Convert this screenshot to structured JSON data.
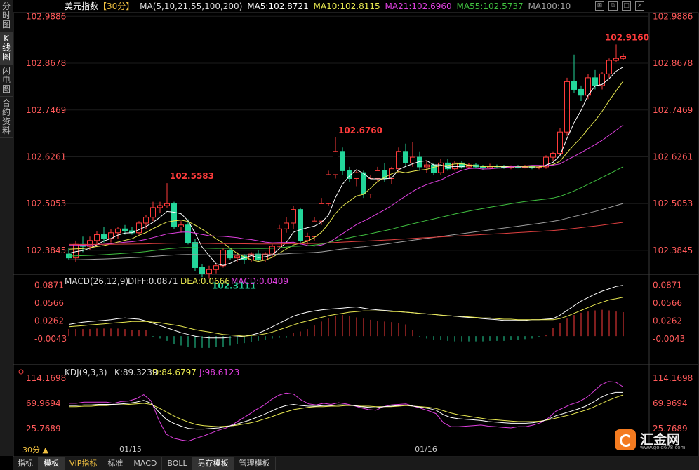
{
  "sidebar": {
    "tabs": [
      {
        "label": "分时图",
        "active": false
      },
      {
        "label": "K线图",
        "active": true
      },
      {
        "label": "闪电图",
        "active": false
      },
      {
        "label": "合约资料",
        "active": false
      }
    ]
  },
  "header": {
    "symbol": "美元指数",
    "period": "【30分】",
    "ma_legend": "MA(5,10,21,55,100,200)",
    "ma5": "MA5:102.8721",
    "ma10": "MA10:102.8115",
    "ma21": "MA21:102.6960",
    "ma55": "MA55:102.5737",
    "ma100": "MA100:10"
  },
  "colors": {
    "up": "#ff3b3b",
    "down": "#23d69a",
    "ma5": "#ffffff",
    "ma10": "#e8e850",
    "ma21": "#e040e0",
    "ma55": "#40c040",
    "ma100": "#a0a0a0",
    "ma200": "#e04040",
    "price_axis": "#ff5a5a",
    "indicator_axis": "#ff5a5a"
  },
  "price_axis": [
    "102.9886",
    "102.8678",
    "102.7469",
    "102.6261",
    "102.5053",
    "102.3845"
  ],
  "annotations": {
    "h1": "102.5583",
    "low": "102.3111",
    "h2": "102.6760",
    "h3": "102.9160"
  },
  "date_labels": [
    "01/15",
    "01/16"
  ],
  "macd": {
    "title": "MACD(26,12,9)",
    "diff": "DIFF:0.0871",
    "dea": "DEA:0.0666",
    "macd": "MACD:0.0409",
    "axis": [
      "0.0871",
      "0.0566",
      "0.0262",
      "-0.0043"
    ]
  },
  "kdj": {
    "title": "KDJ(9,3,3)",
    "k": "K:89.3239",
    "d": "D:84.6797",
    "j": "J:98.6123",
    "axis": [
      "114.1698",
      "69.9694",
      "25.7689"
    ]
  },
  "bottom_bar": {
    "period_label": "30分 ▲",
    "tabs": [
      {
        "label": "指标",
        "active": false
      },
      {
        "label": "模板",
        "active": true
      },
      {
        "label": "VIP指标",
        "active": false
      },
      {
        "label": "标准",
        "active": false
      },
      {
        "label": "MACD",
        "active": false
      },
      {
        "label": "BOLL",
        "active": false
      },
      {
        "label": "另存模板",
        "active": true
      },
      {
        "label": "管理模板",
        "active": false
      }
    ]
  },
  "logo": {
    "text": "汇金网",
    "url": "www.gold678.com"
  },
  "chart_data": [
    {
      "type": "candlestick",
      "title": "美元指数 30分",
      "ylim": [
        102.33,
        103.0
      ],
      "candles": [
        [
          102.375,
          102.39,
          102.36,
          102.365
        ],
        [
          102.365,
          102.41,
          102.355,
          102.4
        ],
        [
          102.4,
          102.42,
          102.38,
          102.395
        ],
        [
          102.395,
          102.42,
          102.385,
          102.41
        ],
        [
          102.41,
          102.435,
          102.4,
          102.425
        ],
        [
          102.425,
          102.445,
          102.405,
          102.415
        ],
        [
          102.415,
          102.44,
          102.405,
          102.43
        ],
        [
          102.43,
          102.445,
          102.415,
          102.44
        ],
        [
          102.44,
          102.45,
          102.425,
          102.435
        ],
        [
          102.435,
          102.445,
          102.425,
          102.43
        ],
        [
          102.43,
          102.46,
          102.425,
          102.455
        ],
        [
          102.455,
          102.475,
          102.44,
          102.47
        ],
        [
          102.47,
          102.51,
          102.46,
          102.495
        ],
        [
          102.495,
          102.51,
          102.48,
          102.5
        ],
        [
          102.5,
          102.558,
          102.495,
          102.505
        ],
        [
          102.505,
          102.51,
          102.44,
          102.445
        ],
        [
          102.445,
          102.46,
          102.43,
          102.45
        ],
        [
          102.45,
          102.465,
          102.4,
          102.405
        ],
        [
          102.405,
          102.415,
          102.33,
          102.34
        ],
        [
          102.34,
          102.35,
          102.315,
          102.325
        ],
        [
          102.325,
          102.345,
          102.311,
          102.335
        ],
        [
          102.335,
          102.35,
          102.325,
          102.345
        ],
        [
          102.345,
          102.39,
          102.34,
          102.385
        ],
        [
          102.385,
          102.39,
          102.36,
          102.365
        ],
        [
          102.365,
          102.38,
          102.355,
          102.37
        ],
        [
          102.37,
          102.375,
          102.35,
          102.36
        ],
        [
          102.36,
          102.38,
          102.355,
          102.375
        ],
        [
          102.375,
          102.385,
          102.355,
          102.36
        ],
        [
          102.36,
          102.38,
          102.355,
          102.375
        ],
        [
          102.375,
          102.4,
          102.365,
          102.395
        ],
        [
          102.395,
          102.45,
          102.39,
          102.44
        ],
        [
          102.44,
          102.47,
          102.43,
          102.455
        ],
        [
          102.455,
          102.5,
          102.44,
          102.49
        ],
        [
          102.49,
          102.495,
          102.4,
          102.41
        ],
        [
          102.41,
          102.43,
          102.4,
          102.42
        ],
        [
          102.42,
          102.47,
          102.41,
          102.46
        ],
        [
          102.46,
          102.52,
          102.45,
          102.505
        ],
        [
          102.505,
          102.59,
          102.5,
          102.58
        ],
        [
          102.58,
          102.676,
          102.57,
          102.64
        ],
        [
          102.64,
          102.65,
          102.58,
          102.59
        ],
        [
          102.59,
          102.6,
          102.56,
          102.57
        ],
        [
          102.57,
          102.59,
          102.55,
          102.585
        ],
        [
          102.585,
          102.59,
          102.52,
          102.53
        ],
        [
          102.53,
          102.58,
          102.52,
          102.57
        ],
        [
          102.57,
          102.6,
          102.56,
          102.59
        ],
        [
          102.59,
          102.61,
          102.56,
          102.57
        ],
        [
          102.57,
          102.6,
          102.555,
          102.595
        ],
        [
          102.595,
          102.65,
          102.585,
          102.64
        ],
        [
          102.64,
          102.66,
          102.6,
          102.61
        ],
        [
          102.61,
          102.665,
          102.6,
          102.625
        ],
        [
          102.625,
          102.64,
          102.59,
          102.6
        ],
        [
          102.6,
          102.615,
          102.585,
          102.605
        ],
        [
          102.605,
          102.61,
          102.58,
          102.585
        ],
        [
          102.585,
          102.62,
          102.58,
          102.61
        ],
        [
          102.61,
          102.62,
          102.59,
          102.595
        ],
        [
          102.595,
          102.615,
          102.59,
          102.61
        ],
        [
          102.61,
          102.615,
          102.595,
          102.6
        ],
        [
          102.6,
          102.61,
          102.595,
          102.605
        ],
        [
          102.605,
          102.61,
          102.595,
          102.6
        ],
        [
          102.6,
          102.605,
          102.592,
          102.598
        ],
        [
          102.598,
          102.608,
          102.595,
          102.602
        ],
        [
          102.602,
          102.606,
          102.596,
          102.6
        ],
        [
          102.6,
          102.605,
          102.595,
          102.598
        ],
        [
          102.598,
          102.604,
          102.594,
          102.602
        ],
        [
          102.602,
          102.605,
          102.596,
          102.599
        ],
        [
          102.599,
          102.605,
          102.596,
          102.601
        ],
        [
          102.601,
          102.603,
          102.594,
          102.598
        ],
        [
          102.598,
          102.603,
          102.594,
          102.6
        ],
        [
          102.6,
          102.63,
          102.595,
          102.625
        ],
        [
          102.625,
          102.64,
          102.615,
          102.635
        ],
        [
          102.635,
          102.7,
          102.63,
          102.69
        ],
        [
          102.69,
          102.83,
          102.68,
          102.82
        ],
        [
          102.82,
          102.89,
          102.79,
          102.8
        ],
        [
          102.8,
          102.81,
          102.77,
          102.785
        ],
        [
          102.785,
          102.84,
          102.775,
          102.83
        ],
        [
          102.83,
          102.85,
          102.8,
          102.81
        ],
        [
          102.81,
          102.845,
          102.8,
          102.84
        ],
        [
          102.84,
          102.88,
          102.83,
          102.875
        ],
        [
          102.875,
          102.916,
          102.87,
          102.88
        ],
        [
          102.88,
          102.892,
          102.876,
          102.885
        ]
      ]
    },
    {
      "type": "bar",
      "title": "MACD(26,12,9)",
      "ylim": [
        -0.025,
        0.095
      ],
      "values": [
        0.012,
        0.012,
        0.012,
        0.012,
        0.013,
        0.013,
        0.013,
        0.013,
        0.012,
        0.011,
        0.01,
        0.01,
        -0.001,
        -0.004,
        -0.008,
        -0.014,
        -0.016,
        -0.018,
        -0.02,
        -0.02,
        -0.02,
        -0.019,
        -0.018,
        -0.016,
        -0.014,
        -0.012,
        -0.01,
        -0.008,
        -0.006,
        -0.004,
        -0.003,
        -0.003,
        0.005,
        0.008,
        0.012,
        0.018,
        0.025,
        0.03,
        0.034,
        0.036,
        0.035,
        0.032,
        0.03,
        0.028,
        0.026,
        0.025,
        0.024,
        0.022,
        0.02,
        0.01,
        -0.002,
        -0.004,
        -0.006,
        -0.007,
        -0.008,
        -0.009,
        -0.009,
        -0.009,
        -0.009,
        -0.009,
        -0.008,
        -0.008,
        -0.008,
        -0.007,
        -0.006,
        -0.005,
        -0.004,
        -0.002,
        0.002,
        0.014,
        0.022,
        0.03,
        0.036,
        0.04,
        0.042,
        0.044,
        0.045,
        0.044,
        0.042,
        0.041
      ],
      "diff": [
        0.02,
        0.022,
        0.024,
        0.025,
        0.026,
        0.027,
        0.028,
        0.03,
        0.031,
        0.03,
        0.029,
        0.026,
        0.022,
        0.018,
        0.014,
        0.01,
        0.006,
        0.003,
        0.0,
        -0.002,
        -0.003,
        -0.003,
        -0.003,
        -0.002,
        -0.001,
        0.0,
        0.002,
        0.005,
        0.01,
        0.016,
        0.022,
        0.028,
        0.034,
        0.038,
        0.041,
        0.043,
        0.045,
        0.046,
        0.047,
        0.048,
        0.049,
        0.05,
        0.048,
        0.046,
        0.045,
        0.044,
        0.043,
        0.042,
        0.041,
        0.04,
        0.039,
        0.038,
        0.037,
        0.036,
        0.035,
        0.034,
        0.033,
        0.032,
        0.031,
        0.03,
        0.029,
        0.028,
        0.027,
        0.027,
        0.027,
        0.027,
        0.028,
        0.028,
        0.029,
        0.03,
        0.036,
        0.044,
        0.052,
        0.06,
        0.066,
        0.072,
        0.077,
        0.081,
        0.085,
        0.0871
      ],
      "dea": [
        0.016,
        0.017,
        0.018,
        0.019,
        0.02,
        0.021,
        0.022,
        0.023,
        0.024,
        0.025,
        0.025,
        0.025,
        0.024,
        0.023,
        0.021,
        0.019,
        0.017,
        0.014,
        0.011,
        0.009,
        0.007,
        0.005,
        0.003,
        0.002,
        0.001,
        0.0,
        0.001,
        0.002,
        0.004,
        0.007,
        0.011,
        0.015,
        0.019,
        0.023,
        0.026,
        0.029,
        0.032,
        0.035,
        0.037,
        0.039,
        0.041,
        0.042,
        0.043,
        0.043,
        0.043,
        0.043,
        0.042,
        0.042,
        0.041,
        0.04,
        0.039,
        0.038,
        0.037,
        0.036,
        0.035,
        0.034,
        0.034,
        0.033,
        0.032,
        0.031,
        0.031,
        0.03,
        0.029,
        0.029,
        0.028,
        0.028,
        0.028,
        0.028,
        0.028,
        0.028,
        0.03,
        0.034,
        0.039,
        0.044,
        0.049,
        0.054,
        0.058,
        0.062,
        0.064,
        0.0666
      ]
    },
    {
      "type": "line",
      "title": "KDJ(9,3,3)",
      "ylim": [
        0,
        125
      ],
      "k": [
        66,
        66,
        67,
        67,
        68,
        68,
        68,
        69,
        70,
        72,
        75,
        70,
        55,
        42,
        35,
        30,
        26,
        25,
        25,
        26,
        27,
        29,
        32,
        36,
        40,
        45,
        50,
        56,
        62,
        66,
        68,
        66,
        65,
        65,
        66,
        66,
        67,
        67,
        66,
        64,
        63,
        62,
        64,
        65,
        66,
        67,
        65,
        63,
        61,
        58,
        50,
        45,
        43,
        42,
        41,
        40,
        38,
        37,
        36,
        35,
        35,
        35,
        36,
        38,
        42,
        48,
        52,
        56,
        60,
        65,
        72,
        80,
        86,
        89,
        89
      ],
      "d": [
        64,
        64,
        65,
        65,
        66,
        66,
        67,
        67,
        68,
        69,
        70,
        68,
        62,
        55,
        48,
        42,
        37,
        33,
        31,
        30,
        29,
        30,
        31,
        33,
        35,
        38,
        42,
        46,
        51,
        55,
        59,
        61,
        63,
        64,
        64,
        65,
        65,
        66,
        66,
        65,
        65,
        64,
        64,
        64,
        65,
        66,
        65,
        64,
        63,
        61,
        57,
        53,
        50,
        48,
        46,
        44,
        42,
        41,
        40,
        39,
        38,
        38,
        38,
        39,
        41,
        44,
        47,
        50,
        54,
        58,
        63,
        69,
        75,
        80,
        84.68
      ],
      "j": [
        70,
        70,
        72,
        72,
        72,
        72,
        70,
        73,
        74,
        78,
        85,
        74,
        41,
        16,
        9,
        6,
        4,
        9,
        13,
        18,
        23,
        27,
        34,
        42,
        50,
        59,
        66,
        76,
        84,
        88,
        86,
        76,
        69,
        67,
        70,
        68,
        71,
        69,
        66,
        62,
        59,
        58,
        64,
        67,
        68,
        69,
        65,
        61,
        57,
        52,
        36,
        29,
        29,
        30,
        31,
        32,
        30,
        29,
        28,
        27,
        29,
        29,
        32,
        36,
        44,
        56,
        62,
        68,
        72,
        79,
        90,
        102,
        108,
        107,
        98.61
      ]
    }
  ]
}
